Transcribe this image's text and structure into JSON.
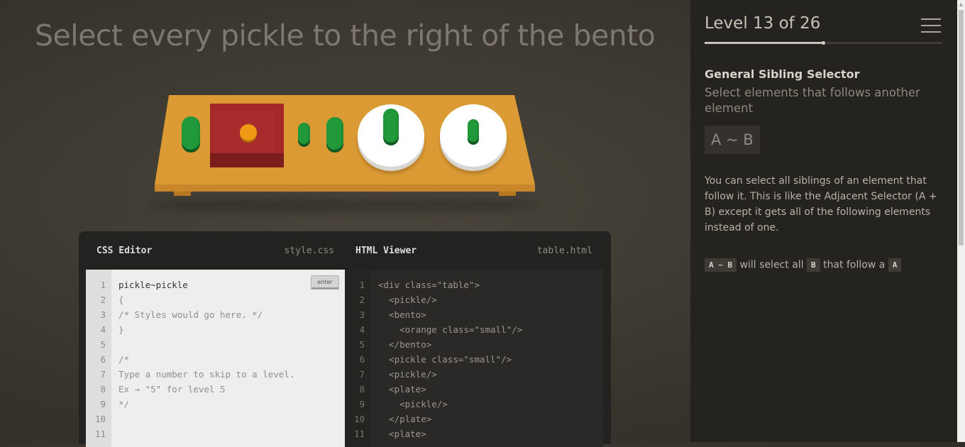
{
  "order": "Select every pickle to the right of the bento",
  "level": {
    "title": "Level 13 of 26",
    "current": 13,
    "total": 26
  },
  "selector": {
    "name": "General Sibling Selector",
    "title": "Select elements that follows another element",
    "syntax": "A ~ B",
    "hint": "You can select all siblings of an element that follow it. This is like the Adjacent Selector (A + B) except it gets all of the following elements instead of one.",
    "example": {
      "tag1": "A ~ B",
      "text1": "will select all",
      "tag2": "B",
      "text2": "that follow a",
      "tag3": "A"
    }
  },
  "css_editor": {
    "title": "CSS Editor",
    "file": "style.css",
    "enter_label": "enter",
    "input_value": "pickle~pickle",
    "lines": [
      "{",
      "/* Styles would go here. */",
      "}",
      "",
      "/*",
      "Type a number to skip to a level.",
      "Ex → \"5\" for level 5",
      "*/",
      "",
      ""
    ],
    "line_numbers": [
      "1",
      "2",
      "3",
      "4",
      "5",
      "6",
      "7",
      "8",
      "9",
      "10",
      "11"
    ]
  },
  "html_viewer": {
    "title": "HTML Viewer",
    "file": "table.html",
    "lines": [
      "<div class=\"table\">",
      "  <pickle/>",
      "  <bento>",
      "    <orange class=\"small\"/>",
      "  </bento>",
      "  <pickle class=\"small\"/>",
      "  <pickle/>",
      "  <plate>",
      "    <pickle/>",
      "  </plate>",
      "  <plate>"
    ],
    "line_numbers": [
      "1",
      "2",
      "3",
      "4",
      "5",
      "6",
      "7",
      "8",
      "9",
      "10",
      "11"
    ]
  },
  "colors": {
    "pickle": "#21993b",
    "bento": "#a4282a",
    "orange": "#ef9a15",
    "table": "#d9962d",
    "plate": "#ffffff"
  },
  "icons": {
    "menu": "menu-icon"
  }
}
